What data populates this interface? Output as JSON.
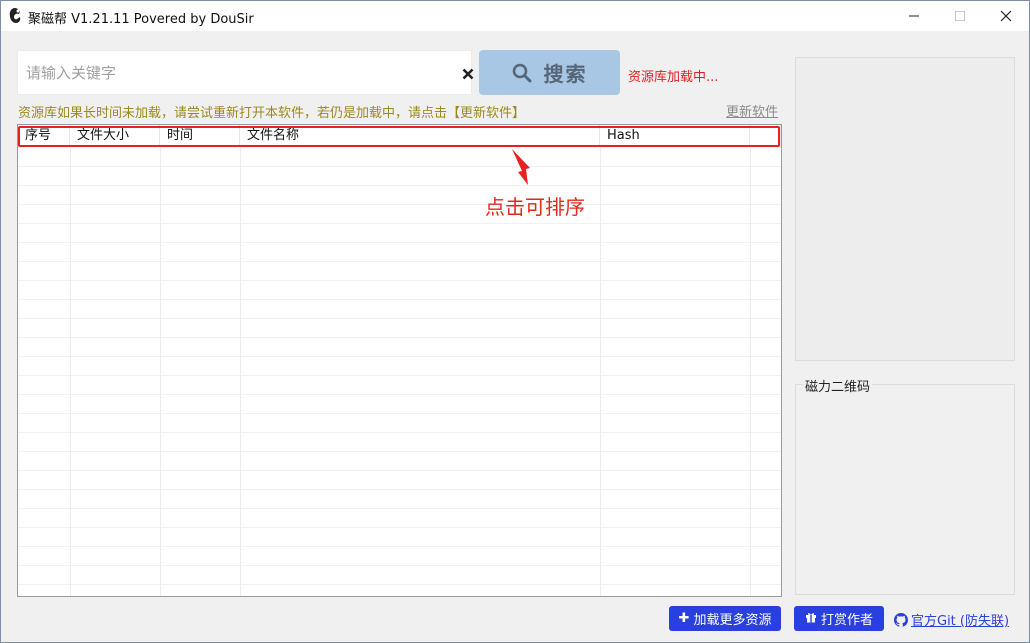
{
  "window": {
    "title": "聚磁帮 V1.21.11 Povered by DouSir",
    "minimize_icon": "minimize-icon",
    "maximize_icon": "maximize-icon",
    "close_icon": "close-icon"
  },
  "search": {
    "placeholder": "请输入关键字",
    "value": "",
    "clear_icon": "close-x-icon",
    "button_label": "搜索",
    "button_icon": "search-icon",
    "status": "资源库加载中..."
  },
  "hint": {
    "text": "资源库如果长时间未加载，请尝试重新打开本软件，若仍是加载中，请点击【更新软件】",
    "update_link": "更新软件"
  },
  "table": {
    "columns": [
      "序号",
      "文件大小",
      "时间",
      "文件名称",
      "Hash",
      ""
    ],
    "rows": []
  },
  "annotation": {
    "text": "点击可排序",
    "color": "#e02a1f"
  },
  "qr_panel": {
    "legend": "磁力二维码"
  },
  "footer": {
    "load_more_label": "加载更多资源",
    "load_more_icon": "plus-icon",
    "donate_label": "打赏作者",
    "donate_icon": "gift-icon",
    "git_label": "官方Git (防失联)",
    "git_icon": "github-icon"
  },
  "colors": {
    "accent_blue": "#2a3fe0",
    "search_button": "#a8c7e4",
    "status_red": "#e02020",
    "hint_olive": "#9a8a1e"
  }
}
